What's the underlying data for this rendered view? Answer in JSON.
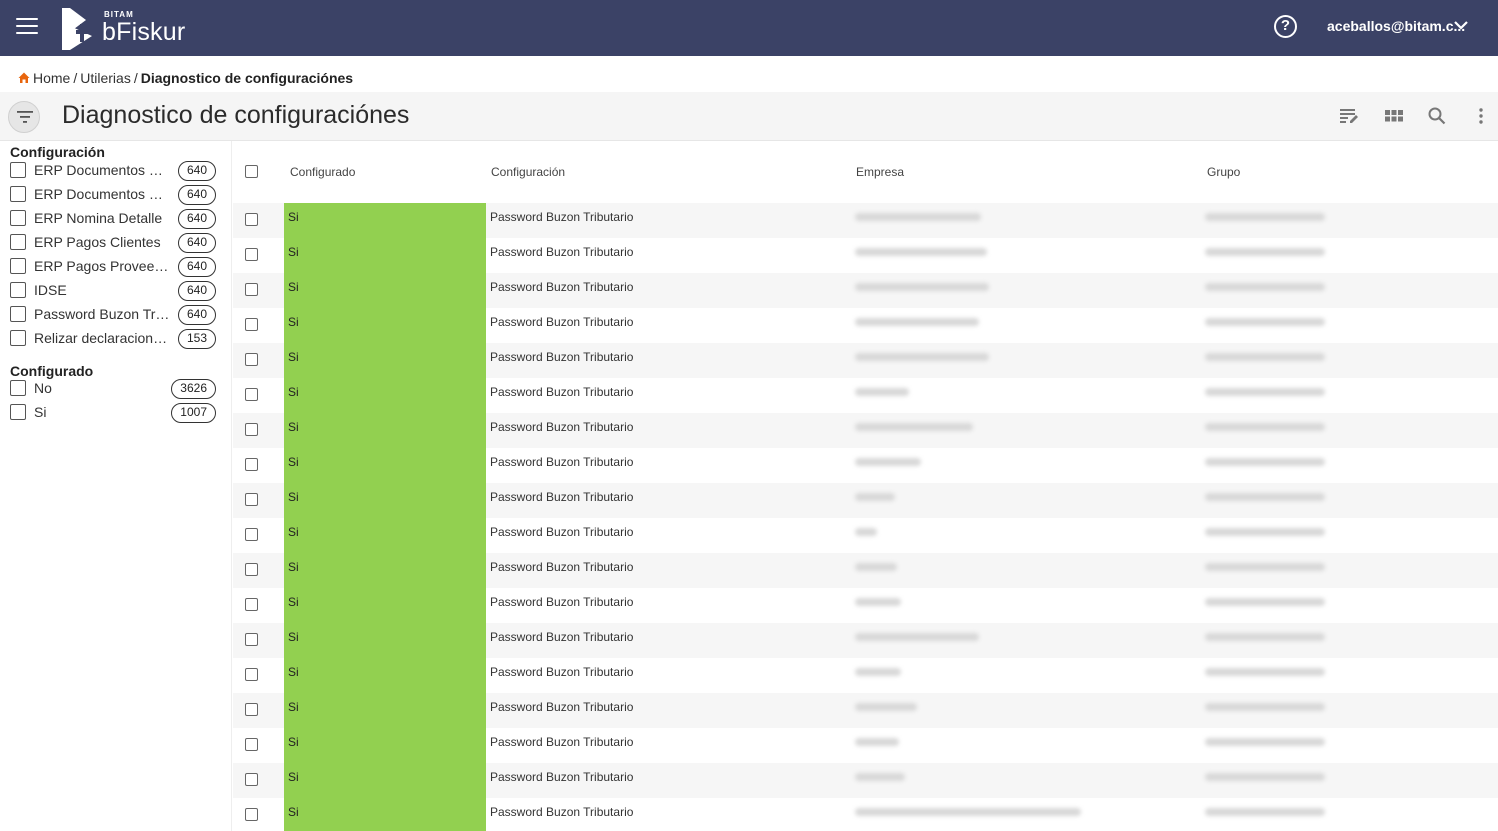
{
  "header": {
    "brand_small": "BITAM",
    "brand": "bFiskur",
    "user": "aceballos@bitam.c...",
    "icons": [
      "menu-icon",
      "logo-icon",
      "help-icon",
      "chevron-down-icon"
    ]
  },
  "breadcrumb": {
    "home": "Home",
    "sep1": "/",
    "utilerias": "Utilerias",
    "sep2": "/",
    "current": "Diagnostico de configuraciónes"
  },
  "page": {
    "title": "Diagnostico de configuraciónes",
    "toolbar_icons": [
      "edit-columns-icon",
      "grid-view-icon",
      "search-icon",
      "more-vert-icon"
    ]
  },
  "facets": {
    "configuracion": {
      "title": "Configuración",
      "items": [
        {
          "label": "ERP Documentos Emitidos",
          "count": "640"
        },
        {
          "label": "ERP Documentos Recibidos",
          "count": "640"
        },
        {
          "label": "ERP Nomina Detalle",
          "count": "640"
        },
        {
          "label": "ERP Pagos Clientes",
          "count": "640"
        },
        {
          "label": "ERP Pagos Proveedores",
          "count": "640"
        },
        {
          "label": "IDSE",
          "count": "640"
        },
        {
          "label": "Password Buzon Tributario",
          "count": "640"
        },
        {
          "label": "Relizar declaraciones mensuales",
          "count": "153"
        }
      ]
    },
    "configurado": {
      "title": "Configurado",
      "items": [
        {
          "label": "No",
          "count": "3626"
        },
        {
          "label": "Si",
          "count": "1007"
        }
      ]
    }
  },
  "table": {
    "columns": [
      "Configurado",
      "Configuración",
      "Empresa",
      "Grupo"
    ],
    "status_color": "#92d050",
    "rows": [
      {
        "configurado": "Si",
        "configuracion": "Password Buzon Tributario"
      },
      {
        "configurado": "Si",
        "configuracion": "Password Buzon Tributario"
      },
      {
        "configurado": "Si",
        "configuracion": "Password Buzon Tributario"
      },
      {
        "configurado": "Si",
        "configuracion": "Password Buzon Tributario"
      },
      {
        "configurado": "Si",
        "configuracion": "Password Buzon Tributario"
      },
      {
        "configurado": "Si",
        "configuracion": "Password Buzon Tributario"
      },
      {
        "configurado": "Si",
        "configuracion": "Password Buzon Tributario"
      },
      {
        "configurado": "Si",
        "configuracion": "Password Buzon Tributario"
      },
      {
        "configurado": "Si",
        "configuracion": "Password Buzon Tributario"
      },
      {
        "configurado": "Si",
        "configuracion": "Password Buzon Tributario"
      },
      {
        "configurado": "Si",
        "configuracion": "Password Buzon Tributario"
      },
      {
        "configurado": "Si",
        "configuracion": "Password Buzon Tributario"
      },
      {
        "configurado": "Si",
        "configuracion": "Password Buzon Tributario"
      },
      {
        "configurado": "Si",
        "configuracion": "Password Buzon Tributario"
      },
      {
        "configurado": "Si",
        "configuracion": "Password Buzon Tributario"
      },
      {
        "configurado": "Si",
        "configuracion": "Password Buzon Tributario"
      },
      {
        "configurado": "Si",
        "configuracion": "Password Buzon Tributario"
      },
      {
        "configurado": "Si",
        "configuracion": "Password Buzon Tributario"
      }
    ]
  }
}
